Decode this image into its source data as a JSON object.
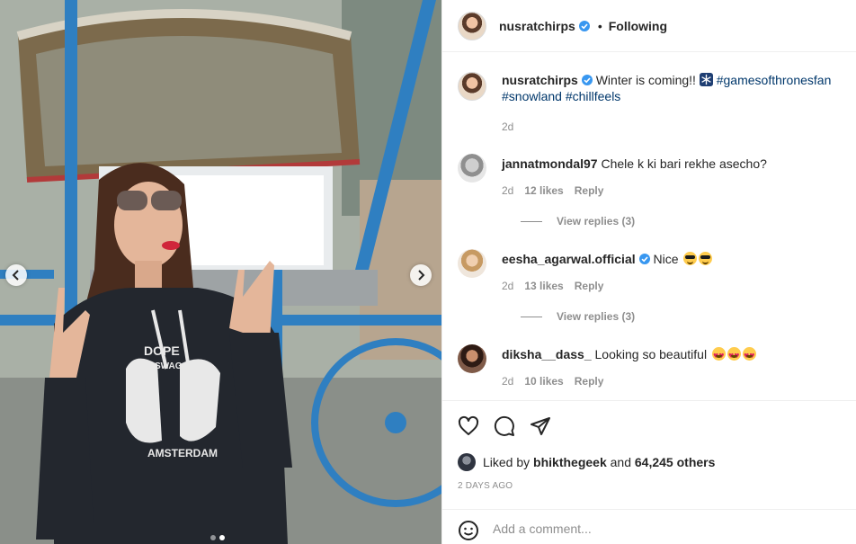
{
  "post": {
    "author": "nusratchirps",
    "follow_status": "Following",
    "separator": "•",
    "caption": {
      "username": "nusratchirps",
      "text": "Winter is coming!!",
      "emoji_icon": "snowflake-icon",
      "hashtag_1": "#gamesofthronesfan",
      "hashtag_2": "#snowland",
      "hashtag_3": "#chillfeels",
      "age": "2d"
    },
    "photo": {
      "hoodie_text_1": "DOPE",
      "hoodie_text_2": "SWAG",
      "hoodie_text_3": "AMSTERDAM"
    }
  },
  "comments": [
    {
      "username": "jannatmondal97",
      "text": "Chele k ki bari rekhe asecho?",
      "age": "2d",
      "likes": "12 likes",
      "reply_label": "Reply",
      "view_replies": "View replies (3)",
      "verified": false
    },
    {
      "username": "eesha_agarwal.official",
      "text": "Nice",
      "emoji": "sunglasses-emoji x2",
      "age": "2d",
      "likes": "13 likes",
      "reply_label": "Reply",
      "view_replies": "View replies (3)",
      "verified": true
    },
    {
      "username": "diksha__dass_",
      "text": "Looking so beautiful",
      "emoji": "heart-eyes-emoji x3",
      "age": "2d",
      "likes": "10 likes",
      "reply_label": "Reply",
      "verified": false
    }
  ],
  "likes": {
    "prefix": "Liked by",
    "user": "bhikthegeek",
    "joiner": "and",
    "others": "64,245 others"
  },
  "timestamp": "2 DAYS AGO",
  "add_comment": {
    "placeholder": "Add a comment..."
  },
  "colors": {
    "verified_blue": "#3897f0",
    "hashtag": "#00376b",
    "muted": "#8e8e8e",
    "text": "#262626",
    "border": "#efefef",
    "rickshaw_blue": "#2f7fc1"
  }
}
